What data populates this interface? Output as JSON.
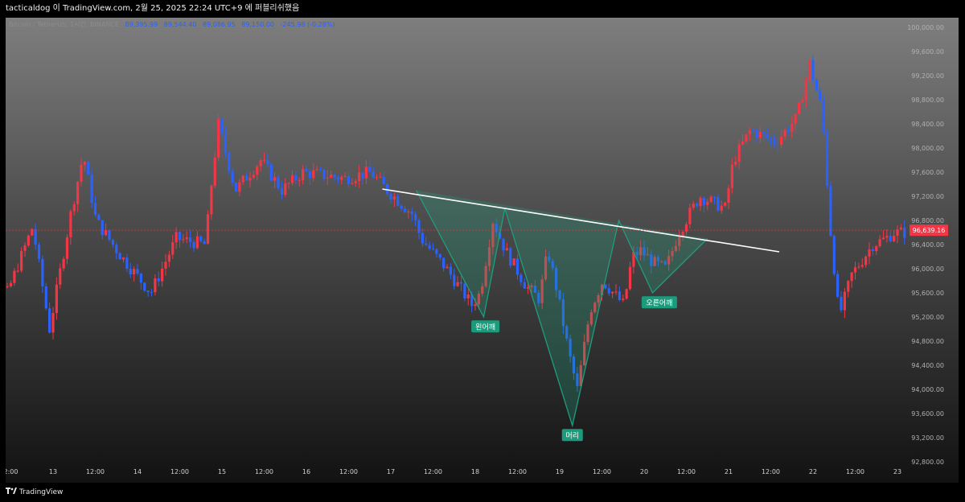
{
  "header": {
    "caption": "tacticaldog 이 TradingView.com, 2월 25, 2025 22:24 UTC+9 에 퍼블리쉬했음"
  },
  "legend": {
    "symbol": "Bitcoin / TetherUS, 1시간, BINANCE",
    "open": "89,395.99",
    "high": "89,544.40",
    "low": "89,086.95",
    "close": "89,150.00",
    "change": "-245.98 (-0.28%)"
  },
  "footer": {
    "brand": "TradingView"
  },
  "chart_data": {
    "type": "candlestick",
    "x_ticks": [
      "2:00",
      "13",
      "12:00",
      "14",
      "12:00",
      "15",
      "12:00",
      "16",
      "12:00",
      "17",
      "12:00",
      "18",
      "12:00",
      "19",
      "12:00",
      "20",
      "12:00",
      "21",
      "12:00",
      "22",
      "12:00",
      "23"
    ],
    "y_ticks": [
      "100,000.00",
      "99,600.00",
      "99,200.00",
      "98,800.00",
      "98,400.00",
      "98,000.00",
      "97,600.00",
      "97,200.00",
      "96,800.00",
      "96,400.00",
      "96,000.00",
      "95,600.00",
      "95,200.00",
      "94,800.00",
      "94,400.00",
      "94,000.00",
      "93,600.00",
      "93,200.00",
      "92,800.00"
    ],
    "ylim": [
      92800,
      100200
    ],
    "current_price_label": "96,639.16",
    "current_price": 96639.16,
    "path_points": [
      [
        12.0,
        96400
      ],
      [
        12.5,
        95600
      ],
      [
        12.8,
        96700
      ],
      [
        13.0,
        95000
      ],
      [
        13.25,
        96900
      ],
      [
        13.4,
        97900
      ],
      [
        13.55,
        96800
      ],
      [
        13.85,
        96200
      ],
      [
        14.2,
        95600
      ],
      [
        14.5,
        96500
      ],
      [
        14.85,
        96400
      ],
      [
        14.9,
        97200
      ],
      [
        15.0,
        98400
      ],
      [
        15.2,
        97300
      ],
      [
        15.5,
        97800
      ],
      [
        15.75,
        97300
      ],
      [
        16.0,
        97600
      ],
      [
        16.5,
        97500
      ],
      [
        16.8,
        97600
      ],
      [
        17.0,
        97300
      ],
      [
        17.3,
        96900
      ],
      [
        17.4,
        96500
      ],
      [
        17.7,
        96000
      ],
      [
        18.0,
        95400
      ],
      [
        18.1,
        95600
      ],
      [
        18.25,
        96800
      ],
      [
        18.4,
        96300
      ],
      [
        18.65,
        95700
      ],
      [
        18.8,
        95500
      ],
      [
        18.9,
        96300
      ],
      [
        19.0,
        95700
      ],
      [
        19.15,
        94600
      ],
      [
        19.25,
        94000
      ],
      [
        19.4,
        95300
      ],
      [
        19.55,
        95800
      ],
      [
        19.8,
        95400
      ],
      [
        19.9,
        96200
      ],
      [
        20.0,
        96300
      ],
      [
        20.15,
        96100
      ],
      [
        20.3,
        96000
      ],
      [
        20.45,
        96600
      ],
      [
        20.7,
        97200
      ],
      [
        21.0,
        97000
      ],
      [
        21.1,
        97800
      ],
      [
        21.3,
        98300
      ],
      [
        21.6,
        98100
      ],
      [
        21.85,
        98500
      ],
      [
        22.0,
        99400
      ],
      [
        22.15,
        98600
      ],
      [
        22.25,
        96600
      ],
      [
        22.35,
        95200
      ],
      [
        22.5,
        95900
      ],
      [
        22.75,
        96400
      ],
      [
        22.9,
        96500
      ],
      [
        23.0,
        96600
      ],
      [
        23.2,
        96600
      ]
    ],
    "trendline": {
      "from": [
        16.9,
        97320
      ],
      "to": [
        21.6,
        96280
      ]
    },
    "pattern": {
      "points": [
        [
          17.3,
          97300
        ],
        [
          18.1,
          95200
        ],
        [
          18.35,
          97000
        ],
        [
          19.15,
          93400
        ],
        [
          19.7,
          96800
        ],
        [
          20.1,
          95600
        ],
        [
          20.75,
          96500
        ]
      ],
      "labels": [
        {
          "text": "왼어깨",
          "x": 18.12,
          "y": 95050
        },
        {
          "text": "머리",
          "x": 19.15,
          "y": 93250
        },
        {
          "text": "오른어깨",
          "x": 20.18,
          "y": 95450
        }
      ]
    },
    "colors": {
      "up": "#f23645",
      "down": "#2962ff",
      "trendline": "#ffffff",
      "pattern_line": "#1f9e7e",
      "pattern_fill": "#1f9e7e",
      "label_bg": "#1a9b7c"
    },
    "grid": false
  }
}
